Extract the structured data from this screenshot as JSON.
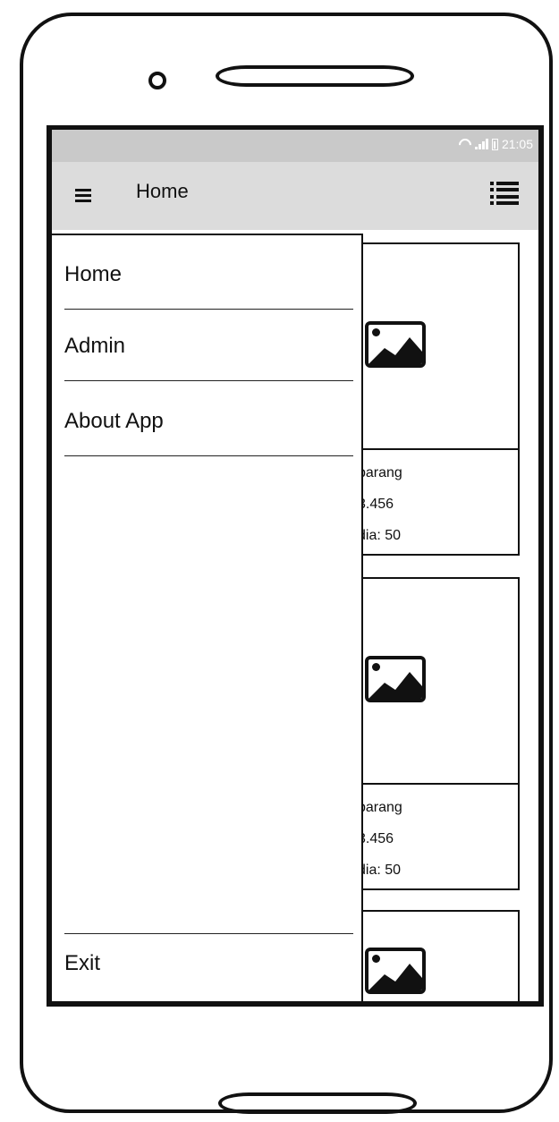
{
  "statusbar": {
    "time": "21:05"
  },
  "appbar": {
    "title": "Home"
  },
  "drawer": {
    "items": [
      {
        "label": "Home"
      },
      {
        "label": "Admin"
      },
      {
        "label": "About App"
      }
    ],
    "exit_label": "Exit"
  },
  "cards": [
    {
      "name": "barang",
      "price": "3.456",
      "stock": "dia: 50"
    },
    {
      "name": "barang",
      "price": "3.456",
      "stock": "dia: 50"
    },
    {
      "name": ""
    }
  ],
  "icons": {
    "menu": "hamburger-menu-icon",
    "list": "list-view-icon",
    "image": "image-placeholder-icon",
    "wifi": "wifi-icon",
    "signal": "signal-icon",
    "battery": "battery-icon"
  }
}
